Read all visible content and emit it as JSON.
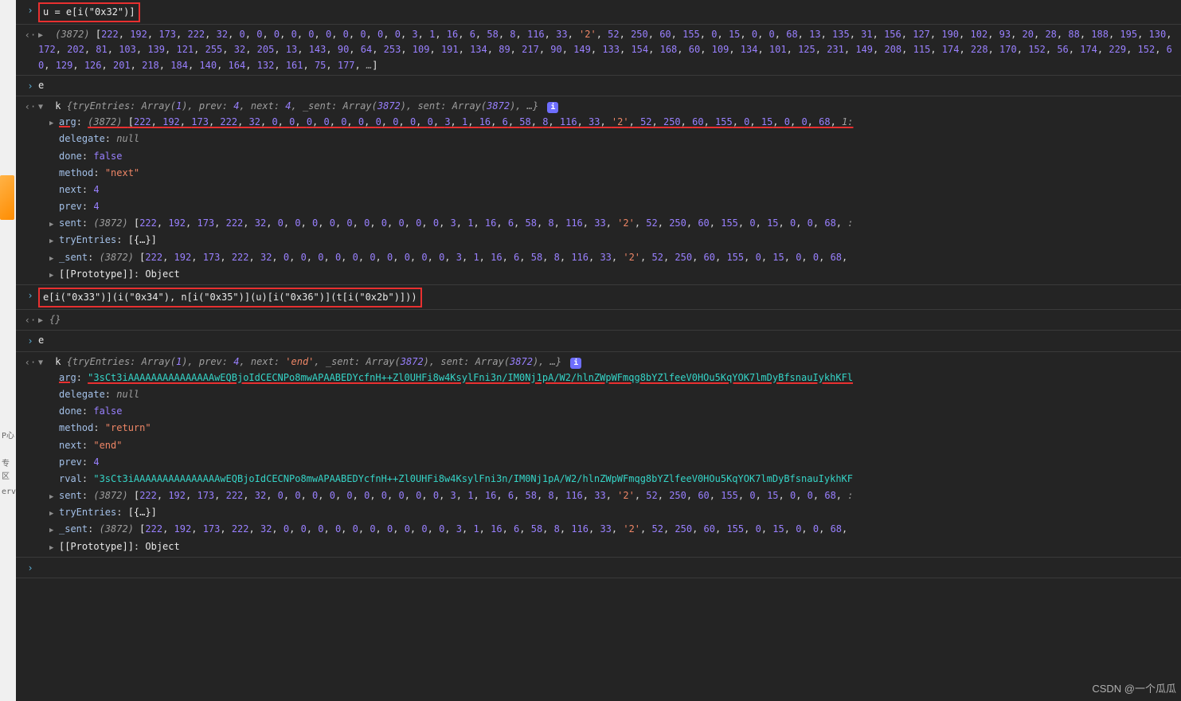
{
  "row1_code": "u = e[i(\"0x32\")]",
  "arr1_head": "(3872)",
  "arr1_values": [
    222,
    192,
    173,
    222,
    32,
    0,
    0,
    0,
    0,
    0,
    0,
    0,
    0,
    0,
    0,
    3,
    1,
    16,
    6,
    58,
    8,
    116,
    33,
    "'2'",
    52,
    250,
    60,
    155,
    0,
    15,
    0,
    0,
    68,
    13,
    135,
    31,
    156,
    127,
    190,
    102,
    93,
    20,
    28,
    88,
    188,
    195,
    130,
    172,
    202,
    81,
    103,
    139,
    121,
    255,
    32,
    205,
    13,
    143,
    90,
    64,
    253,
    109,
    191,
    134,
    89,
    217,
    90,
    149,
    133,
    154,
    168,
    60,
    109,
    134,
    101,
    125,
    231,
    149,
    208,
    115,
    174,
    228,
    170,
    152,
    56,
    174,
    229,
    152,
    60,
    129,
    126,
    201,
    218,
    184,
    140,
    164,
    132,
    161,
    75,
    177,
    "…"
  ],
  "row3": "e",
  "k1_summary": "k {tryEntries: Array(1), prev: 4, next: 4, _sent: Array(3872), sent: Array(3872), …}",
  "k1": {
    "arg_head": "(3872)",
    "arg_vals": [
      222,
      192,
      173,
      222,
      32,
      0,
      0,
      0,
      0,
      0,
      0,
      0,
      0,
      0,
      0,
      3,
      1,
      16,
      6,
      58,
      8,
      116,
      33,
      "'2'",
      52,
      250,
      60,
      155,
      0,
      15,
      0,
      0,
      68,
      "1:"
    ],
    "delegate": "null",
    "done": "false",
    "method": "\"next\"",
    "next": "4",
    "prev": "4",
    "sent_head": "(3872)",
    "sent_vals": [
      222,
      192,
      173,
      222,
      32,
      0,
      0,
      0,
      0,
      0,
      0,
      0,
      0,
      0,
      0,
      3,
      1,
      16,
      6,
      58,
      8,
      116,
      33,
      "'2'",
      52,
      250,
      60,
      155,
      0,
      15,
      0,
      0,
      68,
      ":"
    ],
    "tryEntries": "[{…}]",
    "_sent_head": "(3872)",
    "_sent_vals": [
      222,
      192,
      173,
      222,
      32,
      0,
      0,
      0,
      0,
      0,
      0,
      0,
      0,
      0,
      0,
      3,
      1,
      16,
      6,
      58,
      8,
      116,
      33,
      "'2'",
      52,
      250,
      60,
      155,
      0,
      15,
      0,
      0,
      68,
      ""
    ],
    "proto": "Object"
  },
  "row_red2": "e[i(\"0x33\")](i(\"0x34\"), n[i(\"0x35\")](u)[i(\"0x36\")](t[i(\"0x2b\")]))",
  "row_obj": "{}",
  "row_e2": "e",
  "k2_summary": "k {tryEntries: Array(1), prev: 4, next: 'end', _sent: Array(3872), sent: Array(3872), …}",
  "k2": {
    "arg": "\"3sCt3iAAAAAAAAAAAAAAAwEQBjoIdCECNPo8mwAPAABEDYcfnH++Zl0UHFi8w4KsylFni3n/IM0Nj1pA/W2/hlnZWpWFmqg8bYZlfeeV0HOu5KqYOK7lmDyBfsnauIykhKFl",
    "delegate": "null",
    "done": "false",
    "method": "\"return\"",
    "next": "\"end\"",
    "prev": "4",
    "rval": "\"3sCt3iAAAAAAAAAAAAAAAwEQBjoIdCECNPo8mwAPAABEDYcfnH++Zl0UHFi8w4KsylFni3n/IM0Nj1pA/W2/hlnZWpWFmqg8bYZlfeeV0HOu5KqYOK7lmDyBfsnauIykhKF",
    "sent_head": "(3872)",
    "sent_vals": [
      222,
      192,
      173,
      222,
      32,
      0,
      0,
      0,
      0,
      0,
      0,
      0,
      0,
      0,
      0,
      3,
      1,
      16,
      6,
      58,
      8,
      116,
      33,
      "'2'",
      52,
      250,
      60,
      155,
      0,
      15,
      0,
      0,
      68,
      ":"
    ],
    "tryEntries": "[{…}]",
    "_sent_head": "(3872)",
    "_sent_vals": [
      222,
      192,
      173,
      222,
      32,
      0,
      0,
      0,
      0,
      0,
      0,
      0,
      0,
      0,
      0,
      3,
      1,
      16,
      6,
      58,
      8,
      116,
      33,
      "'2'",
      52,
      250,
      60,
      155,
      0,
      15,
      0,
      0,
      68,
      ""
    ],
    "proto": "Object"
  },
  "watermark": "CSDN @一个瓜瓜",
  "lefttxt1": "P心",
  "lefttxt2": "专区",
  "lefttxt3": "erv"
}
